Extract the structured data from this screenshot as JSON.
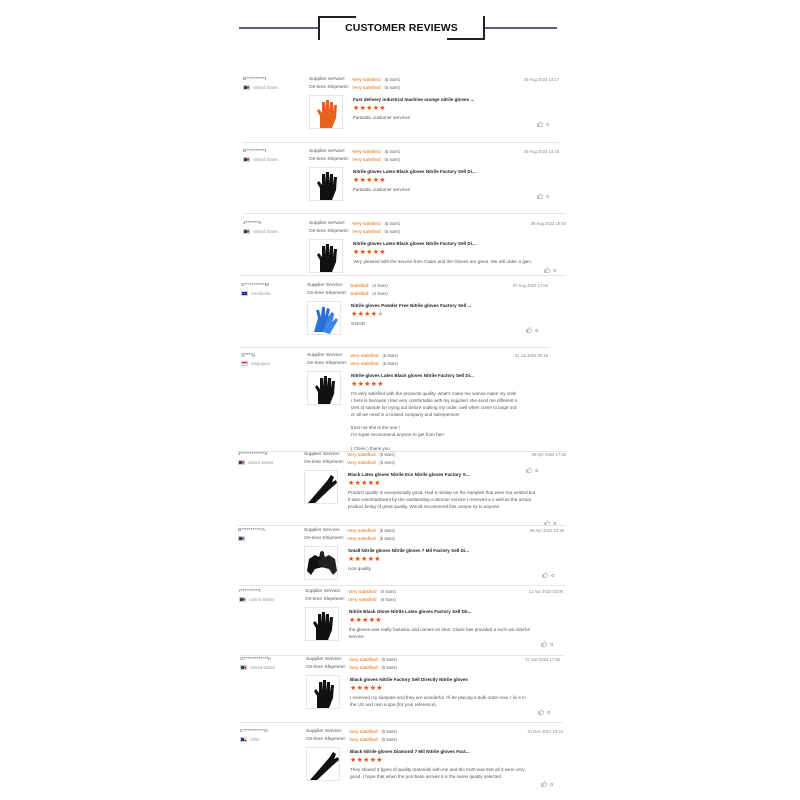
{
  "header": {
    "title": "CUSTOMER REVIEWS"
  },
  "labels": {
    "supplier_service": "Supplier Service:",
    "on_time_shipment": "On-time Shipment:"
  },
  "colors": {
    "accent": "#e26b0a",
    "star": "#e8520f",
    "header_line": "#5b5c80"
  },
  "reviews": [
    {
      "name": "B**********t",
      "country": "United States",
      "flag": "us",
      "supplier": "Very satisfied",
      "supplier_stars": "(5 stars)",
      "shipment": "Very satisfied",
      "shipment_stars": "(5 stars)",
      "date": "29 Aug 2022 14:17",
      "product": "Fast delivery industrial machine orange nitrile gloves ...",
      "rating": 5,
      "comment": "Fantastic customer service!!",
      "likes": "0",
      "image": "orange-glove"
    },
    {
      "name": "B**********t",
      "country": "United States",
      "flag": "us",
      "supplier": "Very satisfied",
      "supplier_stars": "(5 stars)",
      "shipment": "Very satisfied",
      "shipment_stars": "(5 stars)",
      "date": "29 Aug 2022 14:16",
      "product": "Nitrile gloves Latex Black gloves Nitrile Factory Sell Di...",
      "rating": 5,
      "comment": "Fantastic customer service!!",
      "likes": "0",
      "image": "black-glove"
    },
    {
      "name": "J*******n",
      "country": "United States",
      "flag": "us",
      "supplier": "Very satisfied",
      "supplier_stars": "(5 stars)",
      "shipment": "Very satisfied",
      "shipment_stars": "(5 stars)",
      "date": "08 Aug 2022 19:54",
      "product": "Nitrile gloves Latex Black gloves Nitrile Factory Sell Di...",
      "rating": 5,
      "comment": "Very pleased with the service from Claire and the Gloves are great. We will order a gain.",
      "likes": "0",
      "image": "black-glove"
    },
    {
      "name": "S***********M",
      "country": "Cambodia",
      "flag": "kh",
      "supplier": "Satisfied",
      "supplier_stars": "(4 stars)",
      "shipment": "Satisfied",
      "shipment_stars": "(4 stars)",
      "date": "07 Aug 2022 17:04",
      "product": "Nitrile gloves Powder Free Nitrile gloves Factory Sell ...",
      "rating": 4,
      "comment": "GOOD",
      "likes": "0",
      "image": "blue-glove"
    },
    {
      "name": "Q****g",
      "country": "Singapore",
      "flag": "sg",
      "supplier": "Very satisfied",
      "supplier_stars": "(5 stars)",
      "shipment": "Very satisfied",
      "shipment_stars": "(5 stars)",
      "date": "31 Jul 2022 00:19",
      "product": "Nitrile gloves Latex Black gloves Nitrile Factory Sell Di...",
      "rating": 5,
      "comment": "I'm very satisfied with the products quality. what's make me wanna make my orde r here is because I feel very comfortable with my supplier! she send me different s izes of sample for trying out before making my order. well when come to large ord er all we need is a trusted company and salesperson!\n\ntrust me she is the one !\nI'm super recommend anyone to get from her!\n\n( Claire ) thank you",
      "likes": "0",
      "image": "black-glove"
    },
    {
      "name": "J*************ll",
      "country": "United States",
      "flag": "us",
      "supplier": "Very satisfied",
      "supplier_stars": "(5 stars)",
      "shipment": "Very satisfied",
      "shipment_stars": "(5 stars)",
      "date": "28 Apr 2022 17:56",
      "product": "Black Latex gloves Nitrile Eco Nitrile gloves Factory S...",
      "rating": 5,
      "comment": "Product quality is exceptionally good. Had a mixtep on the samples that were req uested but it was overshadowed by the outstanding customer service I received a s well as the actual product being of great quality. Would recommend this compa ny to anyone.",
      "likes": "0",
      "image": "black-glove-diag"
    },
    {
      "name": "B***********A",
      "country": "",
      "flag": "us",
      "supplier": "Very satisfied",
      "supplier_stars": "(5 stars)",
      "shipment": "Very satisfied",
      "shipment_stars": "(5 stars)",
      "date": "26 Apr 2022 10:38",
      "product": "Small Nitrile gloves Nitrile gloves 7 Mil Factory Sell Di...",
      "rating": 5,
      "comment": "nice quality",
      "likes": "0",
      "image": "black-glove-pair"
    },
    {
      "name": "r**********t",
      "country": "United States",
      "flag": "us",
      "supplier": "Very satisfied",
      "supplier_stars": "(5 stars)",
      "shipment": "Very satisfied",
      "shipment_stars": "(5 stars)",
      "date": "12 Apr 2022 03:09",
      "product": "Nitrile Black Glove Nitrile Latex gloves Factory Sell Dir...",
      "rating": 5,
      "comment": "the gloves was really fantastic and comes on time. Claire has provided a such wo nderful service.",
      "likes": "0",
      "image": "black-glove"
    },
    {
      "name": "G*************n",
      "country": "United States",
      "flag": "us",
      "supplier": "Very satisfied",
      "supplier_stars": "(5 stars)",
      "shipment": "Very satisfied",
      "shipment_stars": "(5 stars)",
      "date": "07 Jan 2022 17:56",
      "product": "Black gloves Nitrile Factory Sell Directly Nitrile gloves",
      "rating": 5,
      "comment": "I received my samples and they are wonderful. I'll be placing a bulk order now. I liv e in the US and own a spa (for your reference).",
      "likes": "0",
      "image": "black-glove"
    },
    {
      "name": "C***********O",
      "country": "Chile",
      "flag": "cl",
      "supplier": "Very satisfied",
      "supplier_stars": "(5 stars)",
      "shipment": "Very satisfied",
      "shipment_stars": "(5 stars)",
      "date": "01 Dec 2021 19:24",
      "product": "Black Nitrile gloves Diamond 7 Mil Nitrile gloves Fact...",
      "rating": 5,
      "comment": "They shared 3 types of quality materials with me and the truth was that all 3 were very good. I hope that when the purchase arrives it is the same quality selected.",
      "likes": "0",
      "image": "black-glove-diag"
    }
  ]
}
